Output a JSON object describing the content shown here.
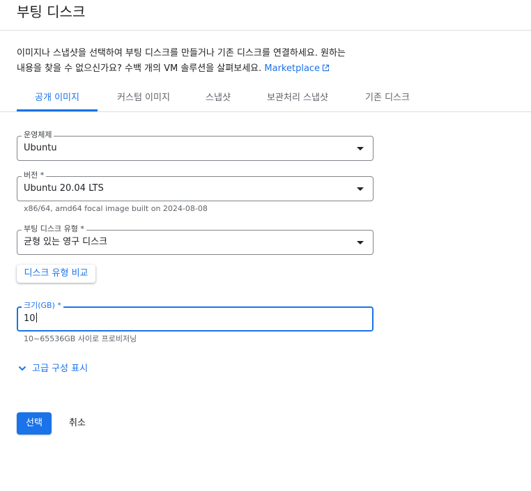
{
  "header": {
    "title": "부팅 디스크"
  },
  "description": {
    "line1": "이미지나 스냅샷을 선택하여 부팅 디스크를 만들거나 기존 디스크를 연결하세요. 원하는",
    "line2": "내용을 찾을 수 없으신가요? 수백 개의 VM 솔루션을 살펴보세요.",
    "link": "Marketplace",
    "link_icon": "external-link-icon"
  },
  "tabs": [
    {
      "label": "공개 이미지",
      "active": true
    },
    {
      "label": "커스텀 이미지",
      "active": false
    },
    {
      "label": "스냅샷",
      "active": false
    },
    {
      "label": "보관처리 스냅샷",
      "active": false
    },
    {
      "label": "기존 디스크",
      "active": false
    }
  ],
  "os_field": {
    "label": "운영체제",
    "value": "Ubuntu"
  },
  "version_field": {
    "label": "버전 *",
    "value": "Ubuntu 20.04 LTS",
    "hint": "x86/64, amd64 focal image built on 2024-08-08"
  },
  "disk_type_field": {
    "label": "부팅 디스크 유형 *",
    "value": "균형 있는 영구 디스크"
  },
  "compare_button": {
    "label": "디스크 유형 비교"
  },
  "size_field": {
    "label": "크기(GB) *",
    "value": "10",
    "hint": "10~65536GB 사이로 프로비저닝"
  },
  "advanced": {
    "label": "고급 구성 표시",
    "icon": "chevron-down-icon"
  },
  "actions": {
    "select": "선택",
    "cancel": "취소"
  },
  "colors": {
    "accent": "#1a73e8",
    "border": "#80868b",
    "divider": "#dadce0",
    "text": "#202124",
    "muted": "#5f6368"
  }
}
